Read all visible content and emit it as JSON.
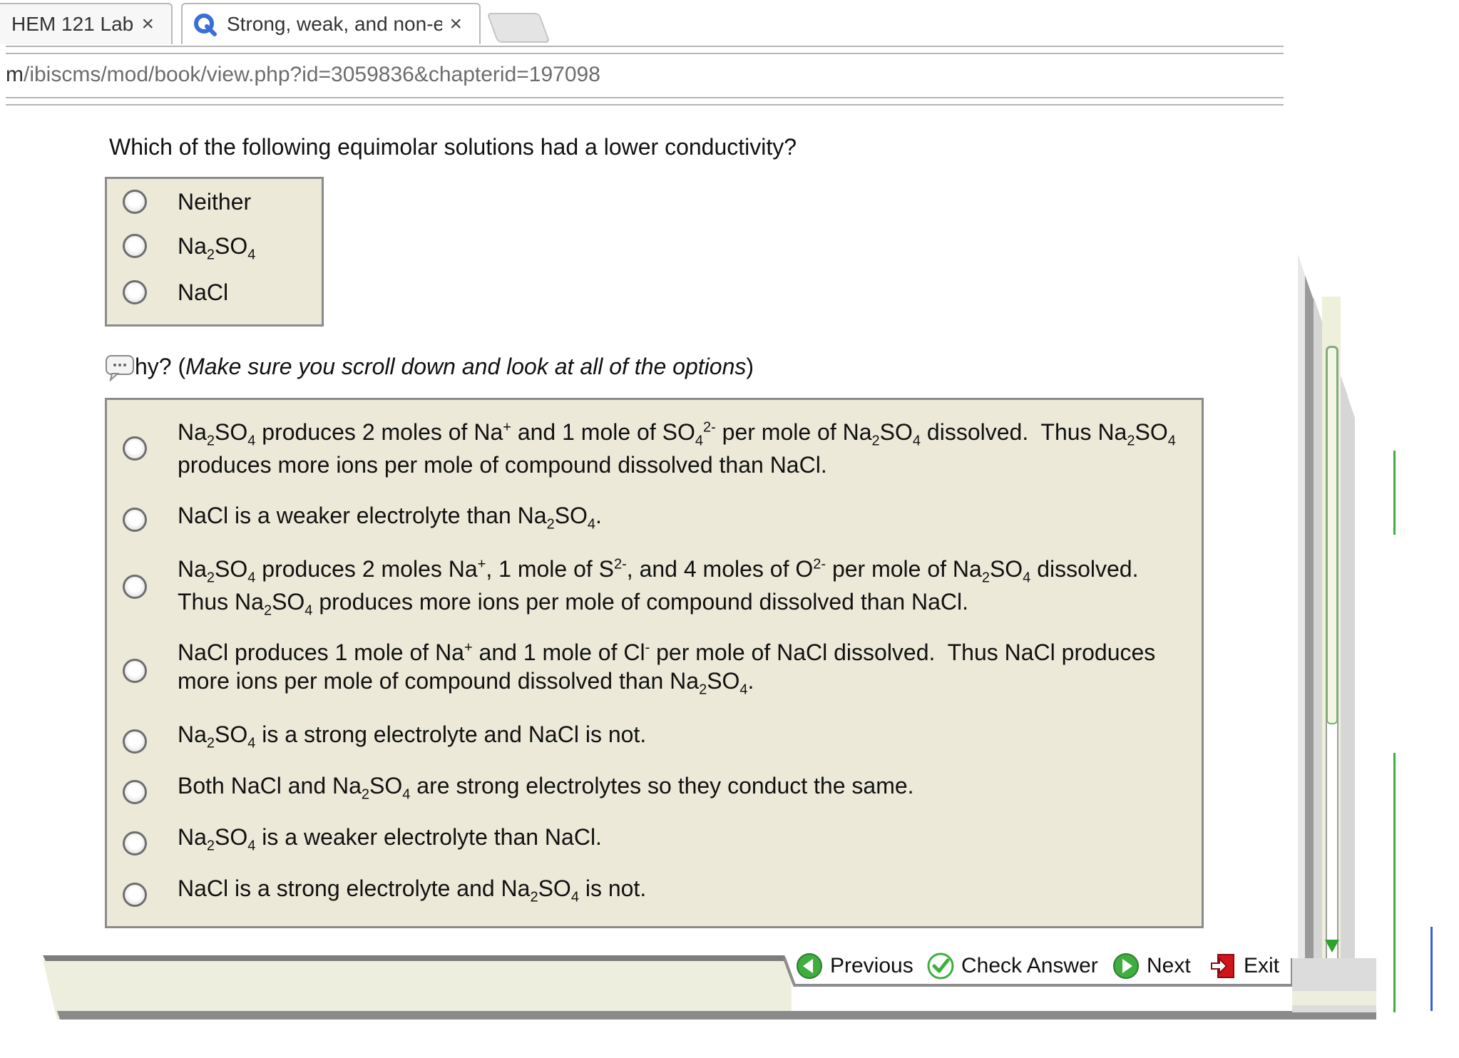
{
  "browser": {
    "tabs": [
      {
        "title": "HEM 121 Lab -",
        "close": "×"
      },
      {
        "title": "Strong, weak, and non-el",
        "close": "×"
      }
    ],
    "url_prefix": "m",
    "url_rest": "/ibiscms/mod/book/view.php?id=3059836&chapterid=197098"
  },
  "quiz": {
    "question": "Which of the following equimolar solutions had a lower conductivity?",
    "why_prefix": "hy?  (",
    "why_italic": "Make sure you scroll down and look at all of the options",
    "why_suffix": ")"
  },
  "nav": {
    "previous": "Previous",
    "check": "Check Answer",
    "next": "Next",
    "exit": "Exit"
  },
  "colors": {
    "panel": "#ece9d8",
    "panel_border": "#8b8b8b",
    "green_icon": "#3fae3f",
    "exit_red": "#d0161b"
  }
}
